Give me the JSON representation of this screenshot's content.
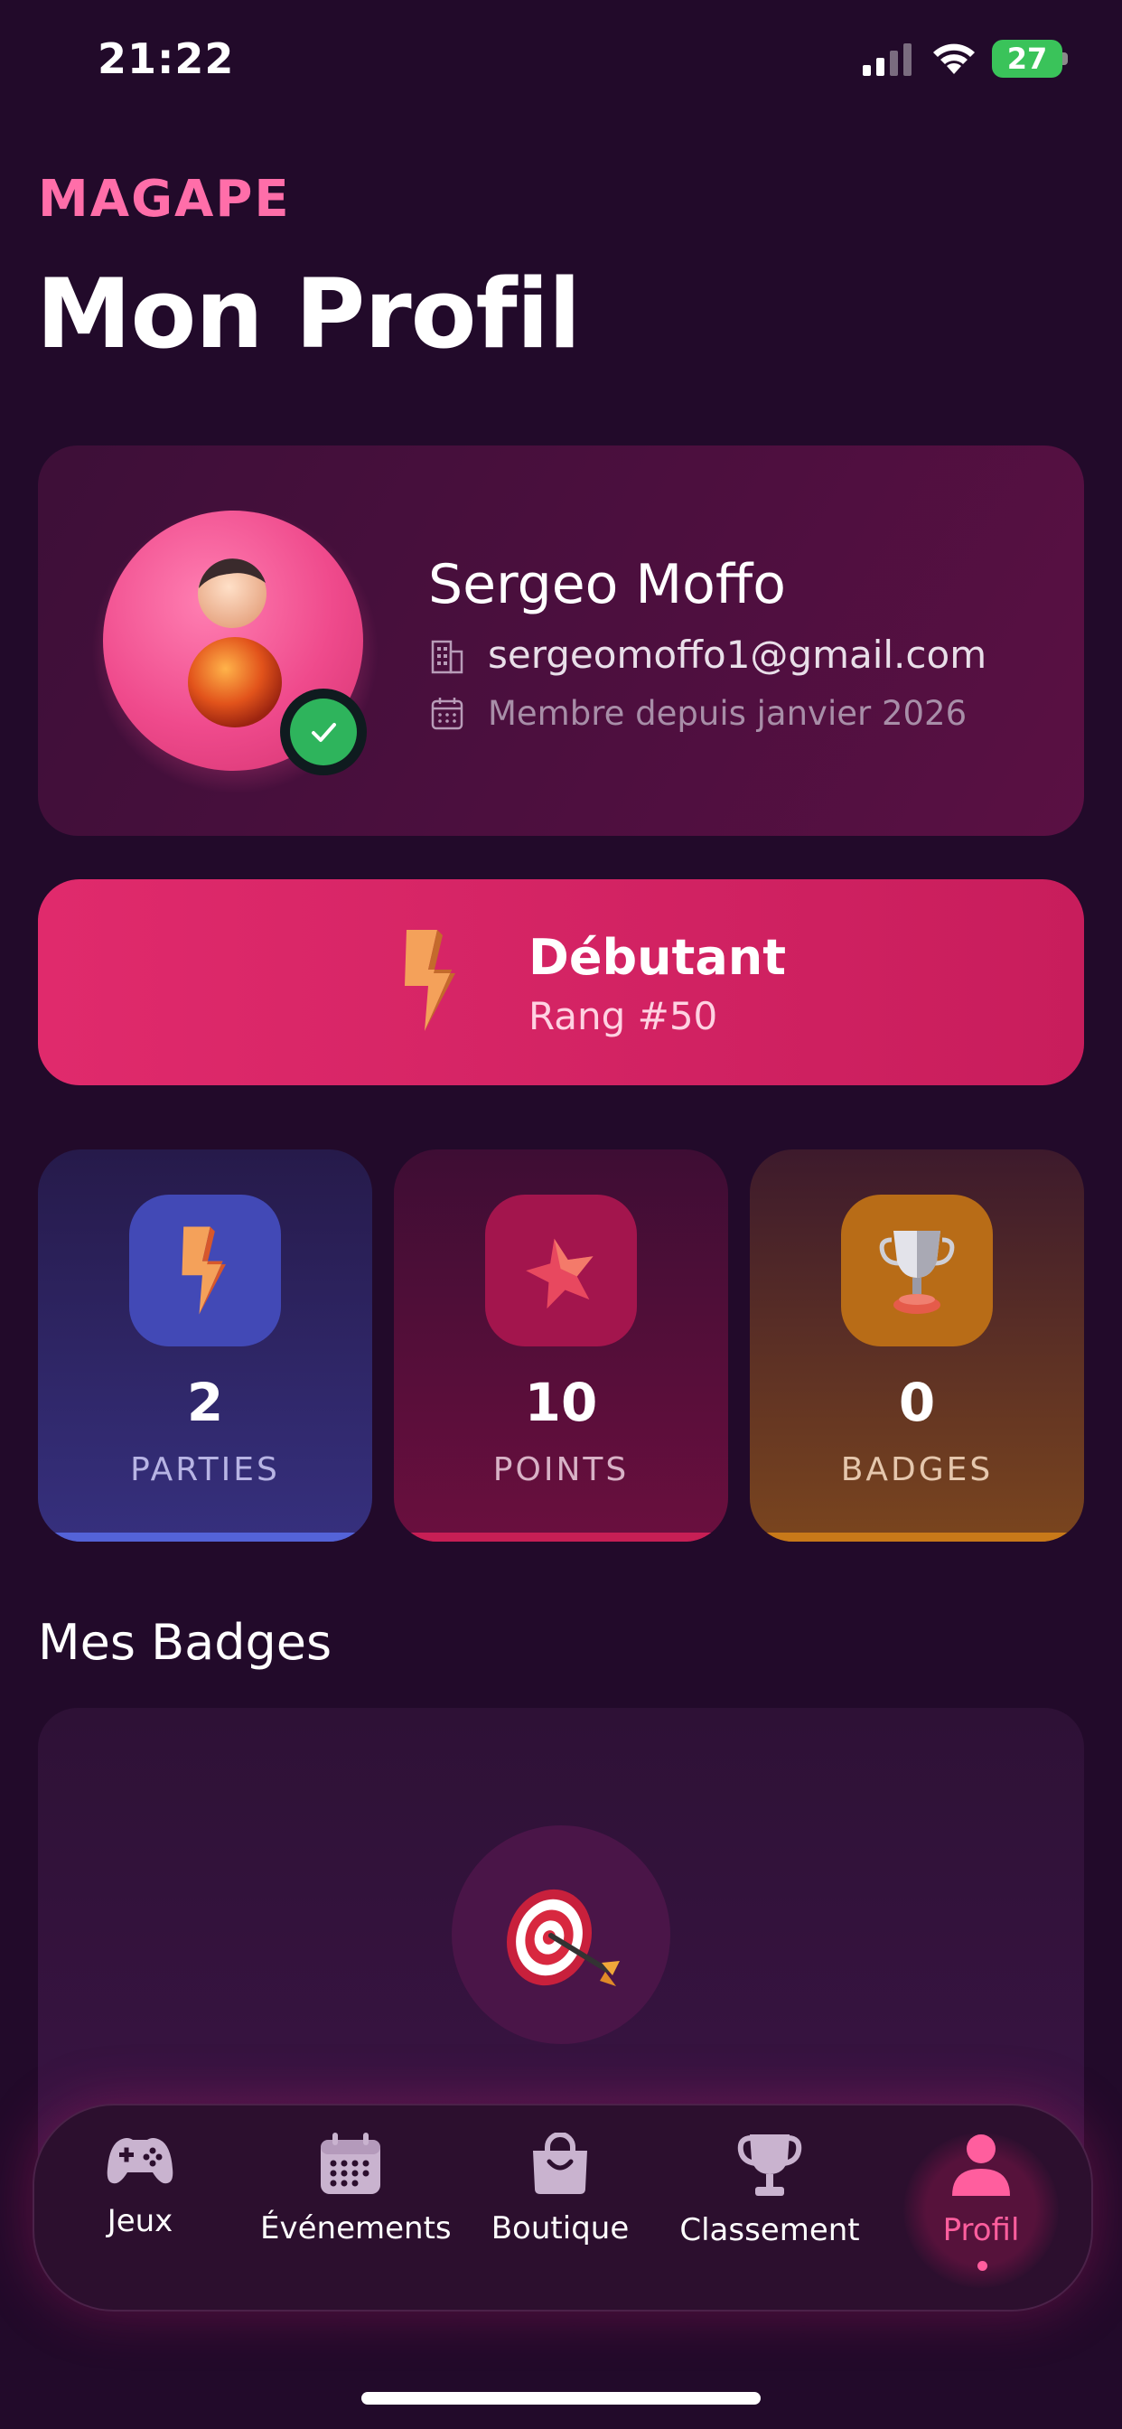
{
  "status_bar": {
    "time": "21:22",
    "battery": "27"
  },
  "header": {
    "brand": "MAGAPE",
    "title": "Mon Profil"
  },
  "profile": {
    "name": "Sergeo Moffo",
    "email": "sergeomoffo1@gmail.com",
    "member_since": "Membre depuis janvier 2026"
  },
  "rank": {
    "title": "Débutant",
    "subtitle": "Rang #50"
  },
  "stats": [
    {
      "value": "2",
      "label": "PARTIES",
      "icon": "lightning-icon"
    },
    {
      "value": "10",
      "label": "POINTS",
      "icon": "star-icon"
    },
    {
      "value": "0",
      "label": "BADGES",
      "icon": "trophy-icon"
    }
  ],
  "badges_section": {
    "title": "Mes Badges",
    "empty_icon": "target-icon"
  },
  "nav": {
    "items": [
      {
        "label": "Jeux",
        "icon": "gamepad-icon"
      },
      {
        "label": "Événements",
        "icon": "calendar-icon"
      },
      {
        "label": "Boutique",
        "icon": "shopping-bag-icon"
      },
      {
        "label": "Classement",
        "icon": "trophy-icon"
      },
      {
        "label": "Profil",
        "icon": "user-icon",
        "active": true
      }
    ]
  },
  "colors": {
    "accent": "#ff6ea9",
    "background": "#220a2a",
    "rank_card": "#d8246a"
  }
}
